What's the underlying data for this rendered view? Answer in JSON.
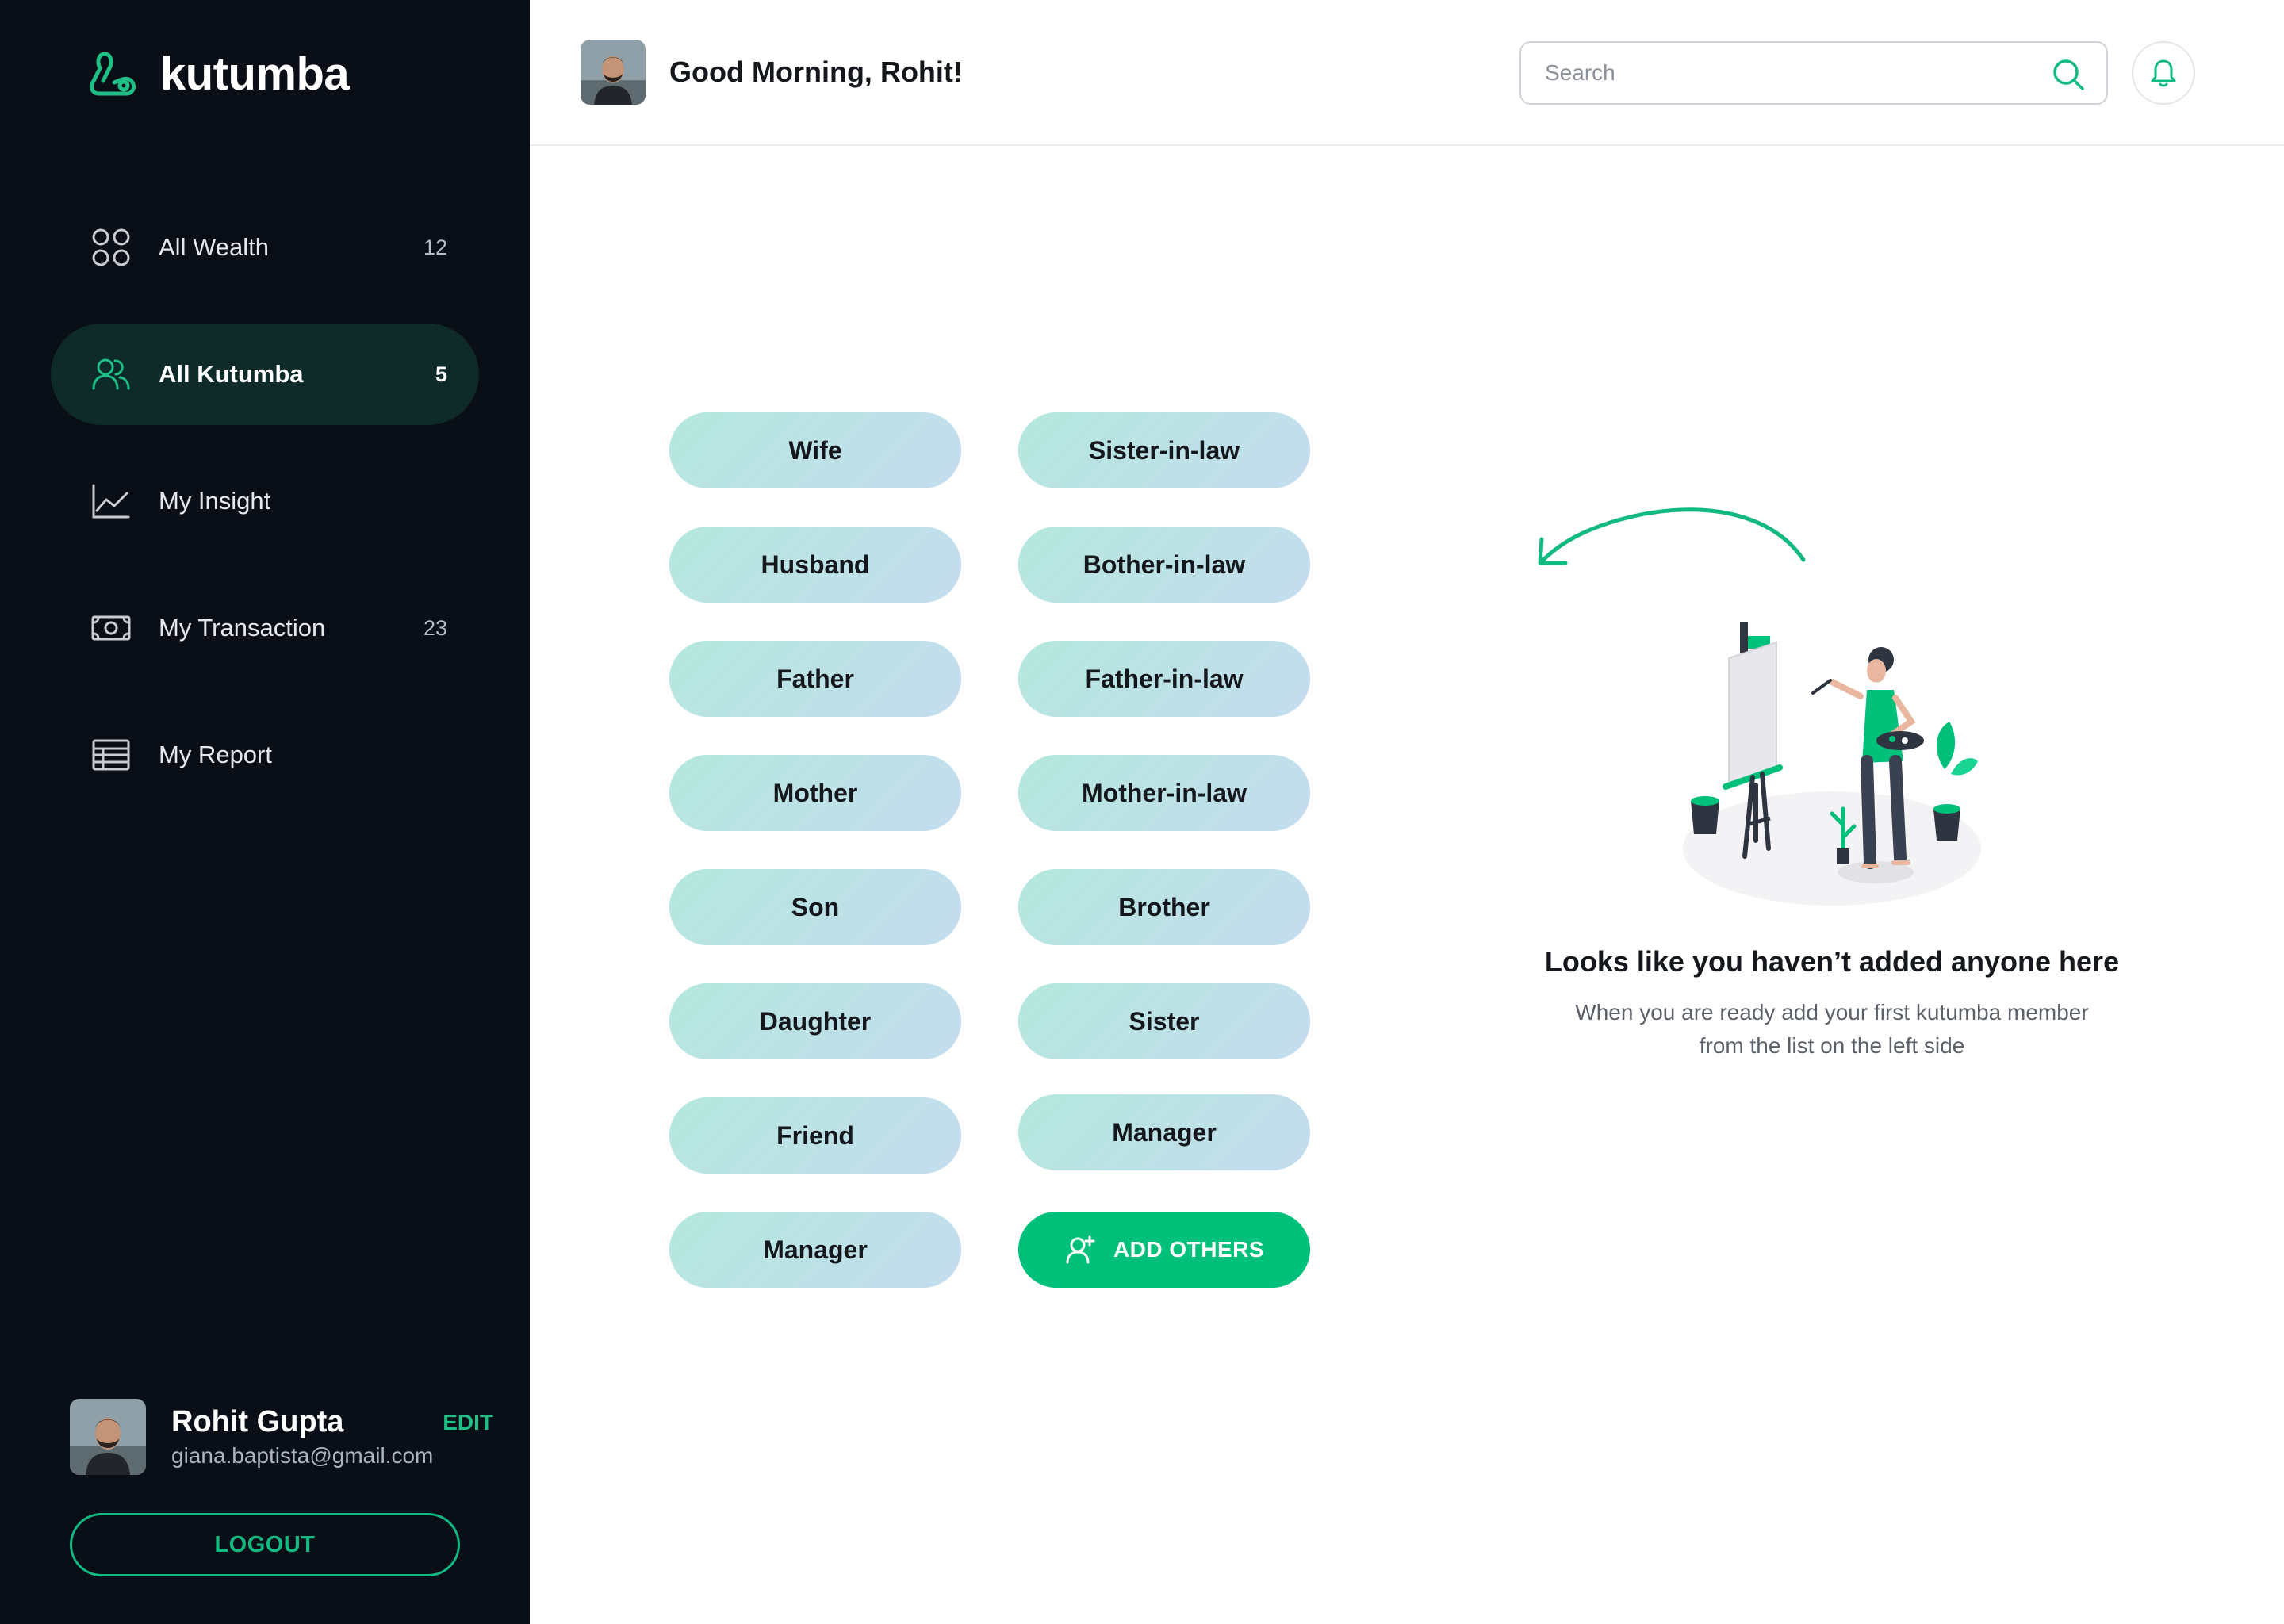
{
  "app": {
    "name": "kutumba"
  },
  "sidebar": {
    "items": [
      {
        "label": "All Wealth",
        "count": "12"
      },
      {
        "label": "All Kutumba",
        "count": "5"
      },
      {
        "label": "My Insight",
        "count": ""
      },
      {
        "label": "My Transaction",
        "count": "23"
      },
      {
        "label": "My Report",
        "count": ""
      }
    ],
    "active_index": 1,
    "profile": {
      "name": "Rohit Gupta",
      "email": "giana.baptista@gmail.com",
      "edit_label": "EDIT"
    },
    "logout_label": "LOGOUT"
  },
  "header": {
    "greeting": "Good Morning, Rohit!",
    "search_placeholder": "Search"
  },
  "relations": {
    "left": [
      "Wife",
      "Husband",
      "Father",
      "Mother",
      "Son",
      "Daughter",
      "Friend",
      "Manager"
    ],
    "right": [
      "Sister-in-law",
      "Bother-in-law",
      "Father-in-law",
      "Mother-in-law",
      "Brother",
      "Sister",
      "Manager"
    ],
    "add_label": "ADD OTHERS"
  },
  "empty_state": {
    "title": "Looks like you haven’t added anyone here",
    "description_line1": "When you are ready add your first kutumba member",
    "description_line2": "from the list on the left side"
  },
  "colors": {
    "accent": "#00c07a",
    "sidebar_bg": "#0a0e17",
    "active_bg": "#0e2b2a"
  },
  "icons": {
    "sidebar": [
      "grid-circles-icon",
      "users-icon",
      "line-chart-icon",
      "money-icon",
      "table-icon"
    ],
    "header": [
      "search-icon",
      "bell-icon"
    ]
  }
}
